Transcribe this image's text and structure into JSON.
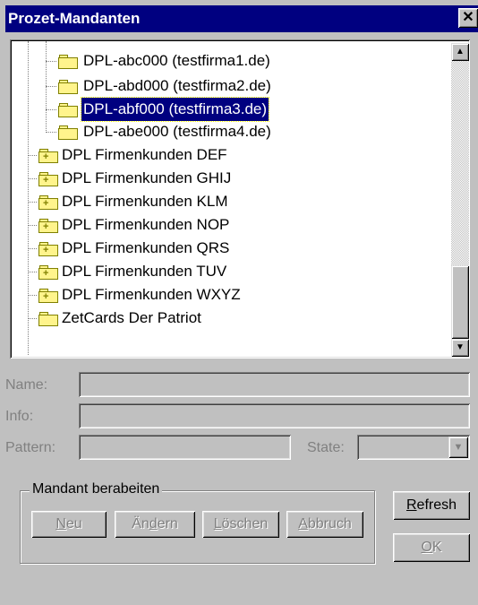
{
  "window": {
    "title": "Prozet-Mandanten",
    "close_glyph": "✕"
  },
  "tree": {
    "children": [
      {
        "label": "DPL-abc000 (testfirma1.de)",
        "selected": false
      },
      {
        "label": "DPL-abd000 (testfirma2.de)",
        "selected": false
      },
      {
        "label": "DPL-abf000 (testfirma3.de)",
        "selected": true
      },
      {
        "label": "DPL-abe000 (testfirma4.de)",
        "selected": false
      }
    ],
    "groups": [
      {
        "label": "DPL Firmenkunden DEF",
        "collapsed": true
      },
      {
        "label": "DPL Firmenkunden GHIJ",
        "collapsed": true
      },
      {
        "label": "DPL Firmenkunden KLM",
        "collapsed": true
      },
      {
        "label": "DPL Firmenkunden NOP",
        "collapsed": true
      },
      {
        "label": "DPL Firmenkunden QRS",
        "collapsed": true
      },
      {
        "label": "DPL Firmenkunden TUV",
        "collapsed": true
      },
      {
        "label": "DPL Firmenkunden WXYZ",
        "collapsed": true
      },
      {
        "label": "ZetCards Der Patriot",
        "collapsed": false
      }
    ],
    "scroll_up_glyph": "▲",
    "scroll_down_glyph": "▼"
  },
  "form": {
    "name_label": "Name:",
    "info_label": "Info:",
    "pattern_label": "Pattern:",
    "state_label": "State:",
    "dropdown_glyph": "▼"
  },
  "group": {
    "title": "Mandant berabeiten",
    "buttons": {
      "neu": {
        "mnemonic": "N",
        "rest": "eu"
      },
      "aendern": {
        "pre": "Än",
        "mnemonic": "d",
        "rest": "ern"
      },
      "loeschen": {
        "mnemonic": "L",
        "rest": "öschen"
      },
      "abbruch": {
        "mnemonic": "A",
        "rest": "bbruch"
      }
    }
  },
  "actions": {
    "refresh": {
      "mnemonic": "R",
      "rest": "efresh"
    },
    "ok": {
      "mnemonic": "O",
      "rest": "K"
    }
  },
  "colors": {
    "titlebar": "#000080",
    "face": "#c0c0c0",
    "selection": "#000080",
    "folder": "#fff48c"
  }
}
